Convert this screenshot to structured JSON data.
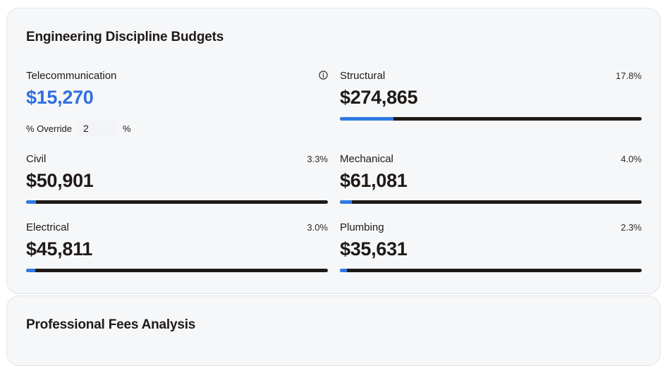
{
  "budgets": {
    "title": "Engineering Discipline Budgets",
    "telecommunication": {
      "label": "Telecommunication",
      "amount": "$15,270",
      "info_icon": "info-circle-icon",
      "override": {
        "label": "% Override",
        "value": "2",
        "unit": "%"
      }
    },
    "structural": {
      "label": "Structural",
      "amount": "$274,865",
      "percent": "17.8%",
      "fill": 0.178
    },
    "civil": {
      "label": "Civil",
      "amount": "$50,901",
      "percent": "3.3%",
      "fill": 0.033
    },
    "mechanical": {
      "label": "Mechanical",
      "amount": "$61,081",
      "percent": "4.0%",
      "fill": 0.04
    },
    "electrical": {
      "label": "Electrical",
      "amount": "$45,811",
      "percent": "3.0%",
      "fill": 0.03
    },
    "plumbing": {
      "label": "Plumbing",
      "amount": "$35,631",
      "percent": "2.3%",
      "fill": 0.023
    }
  },
  "fees": {
    "title": "Professional Fees Analysis"
  },
  "colors": {
    "accent": "#2f6fe0",
    "bar_fill": "#2f7ae5",
    "bar_track": "#1f1a17",
    "card_bg": "#f6f7f8"
  }
}
